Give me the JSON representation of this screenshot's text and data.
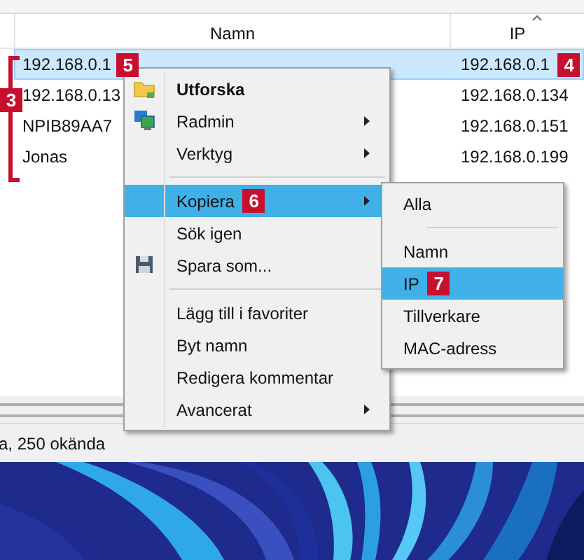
{
  "columns": [
    {
      "label": "Namn",
      "sorted": false
    },
    {
      "label": "IP",
      "sorted": true
    }
  ],
  "list_badge": "3",
  "rows": [
    {
      "name": "192.168.0.1",
      "ip": "192.168.0.1",
      "selected": true,
      "name_badge": "5",
      "ip_badge": "4"
    },
    {
      "name": "192.168.0.13",
      "ip": "192.168.0.134",
      "selected": false
    },
    {
      "name": "NPIB89AA7",
      "ip": "192.168.0.151",
      "selected": false
    },
    {
      "name": "Jonas",
      "ip": "192.168.0.199",
      "selected": false
    }
  ],
  "context_menu": [
    {
      "kind": "item",
      "label": "Utforska",
      "bold": true,
      "icon": true,
      "submenu": false,
      "selected": false
    },
    {
      "kind": "item",
      "label": "Radmin",
      "bold": false,
      "icon": true,
      "submenu": true,
      "selected": false
    },
    {
      "kind": "item",
      "label": "Verktyg",
      "bold": false,
      "icon": false,
      "submenu": true,
      "selected": false
    },
    {
      "kind": "separator"
    },
    {
      "kind": "item",
      "label": "Kopiera",
      "bold": false,
      "icon": false,
      "submenu": true,
      "selected": true,
      "badge": "6"
    },
    {
      "kind": "item",
      "label": "Sök igen",
      "bold": false,
      "icon": false,
      "submenu": false,
      "selected": false
    },
    {
      "kind": "item",
      "label": "Spara som...",
      "bold": false,
      "icon": true,
      "submenu": false,
      "selected": false
    },
    {
      "kind": "separator"
    },
    {
      "kind": "item",
      "label": "Lägg till i favoriter",
      "bold": false,
      "icon": false,
      "submenu": false,
      "selected": false
    },
    {
      "kind": "item",
      "label": "Byt namn",
      "bold": false,
      "icon": false,
      "submenu": false,
      "selected": false
    },
    {
      "kind": "item",
      "label": "Redigera kommentar",
      "bold": false,
      "icon": false,
      "submenu": false,
      "selected": false
    },
    {
      "kind": "item",
      "label": "Avancerat",
      "bold": false,
      "icon": false,
      "submenu": true,
      "selected": false
    }
  ],
  "submenu": [
    {
      "kind": "item",
      "label": "Alla",
      "selected": false
    },
    {
      "kind": "separator"
    },
    {
      "kind": "item",
      "label": "Namn",
      "selected": false
    },
    {
      "kind": "item",
      "label": "IP",
      "selected": true,
      "badge": "7"
    },
    {
      "kind": "item",
      "label": "Tillverkare",
      "selected": false
    },
    {
      "kind": "item",
      "label": "MAC-adress",
      "selected": false
    }
  ],
  "status_bar": "a, 250 okända"
}
